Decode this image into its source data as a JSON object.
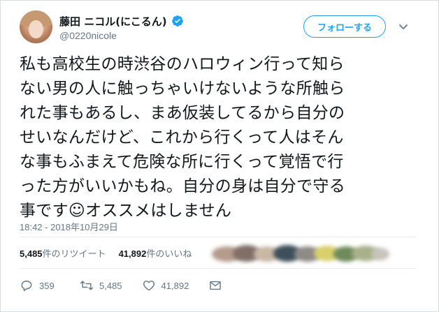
{
  "user": {
    "display_name": "藤田 ニコル(にこるん)",
    "handle": "@0220nicole",
    "verified": true
  },
  "header": {
    "follow_label": "フォローする"
  },
  "tweet": {
    "text": "私も高校生の時渋谷のハロウィン行って知ら\nない男の人に触っちゃいけないような所触ら\nれた事もあるし、まあ仮装してるから自分の\nせいなんだけど、これから行くって人はそん\nな事もふまえて危険な所に行くって覚悟で行\nった方がいいかもね。自分の身は自分で守る\n事です☺オススメはしません",
    "timestamp": "18:42 - 2018年10月29日"
  },
  "stats": {
    "retweets_count": "5,485",
    "retweets_label": "件のリツイート",
    "likes_count": "41,892",
    "likes_label": "件のいいね"
  },
  "actions": {
    "reply_count": "359",
    "retweet_count": "5,485",
    "like_count": "41,892"
  },
  "colors": {
    "accent": "#1da1f2",
    "secondary_text": "#657786",
    "primary_text": "#14171a"
  },
  "icons": [
    "verified-icon",
    "caret-down-icon",
    "reply-icon",
    "retweet-icon",
    "like-icon",
    "message-icon"
  ]
}
